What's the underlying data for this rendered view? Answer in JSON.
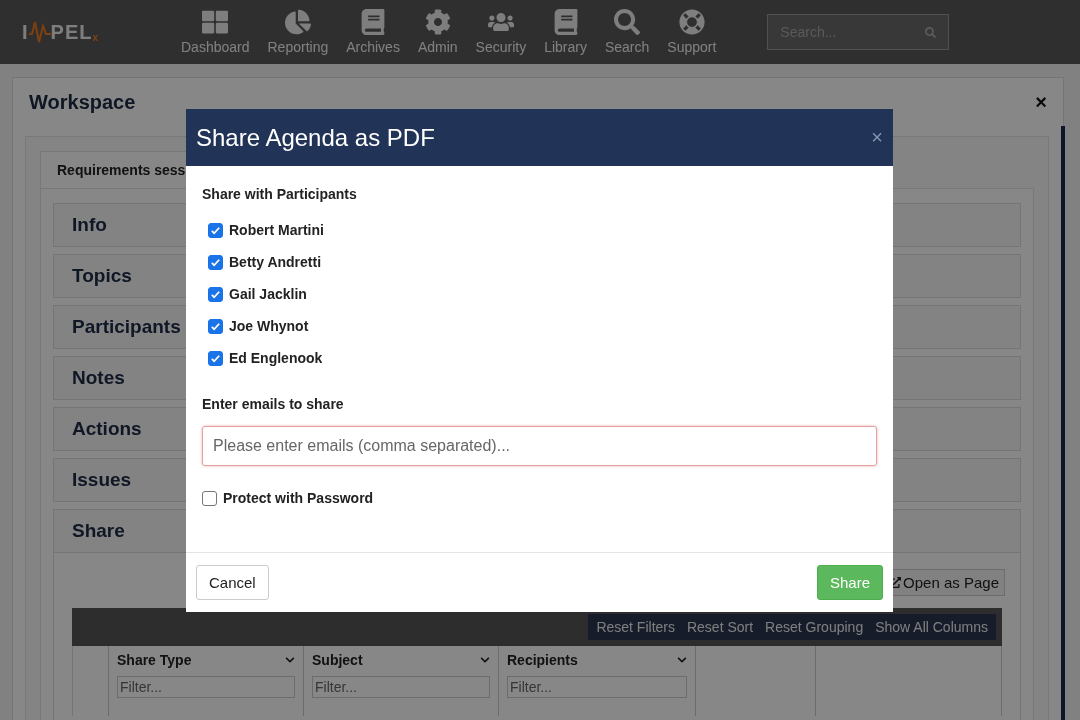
{
  "logo": {
    "left": "I",
    "right": "PEL",
    "superscript": "x"
  },
  "nav": [
    {
      "label": "Dashboard"
    },
    {
      "label": "Reporting"
    },
    {
      "label": "Archives"
    },
    {
      "label": "Admin"
    },
    {
      "label": "Security"
    },
    {
      "label": "Library"
    },
    {
      "label": "Search"
    },
    {
      "label": "Support"
    }
  ],
  "search": {
    "placeholder": "Search..."
  },
  "workspace": {
    "title": "Workspace",
    "close": "×",
    "tab": "Requirements sess",
    "sections": [
      {
        "title": "Info",
        "expanded": false
      },
      {
        "title": "Topics",
        "expanded": false
      },
      {
        "title": "Participants",
        "expanded": false
      },
      {
        "title": "Notes",
        "expanded": false
      },
      {
        "title": "Actions",
        "expanded": false
      },
      {
        "title": "Issues",
        "expanded": false
      },
      {
        "title": "Share",
        "expanded": true
      }
    ],
    "open_as_page": "Open as Page",
    "grid_actions": [
      "Reset Filters",
      "Reset Sort",
      "Reset Grouping",
      "Show All Columns"
    ],
    "columns": [
      {
        "title": "Share Type",
        "filter_placeholder": "Filter..."
      },
      {
        "title": "Subject",
        "filter_placeholder": "Filter..."
      },
      {
        "title": "Recipients",
        "filter_placeholder": "Filter..."
      }
    ]
  },
  "dialog": {
    "title": "Share Agenda as PDF",
    "close": "×",
    "participants_heading": "Share with Participants",
    "participants": [
      {
        "name": "Robert Martini",
        "checked": true
      },
      {
        "name": "Betty Andretti",
        "checked": true
      },
      {
        "name": "Gail Jacklin",
        "checked": true
      },
      {
        "name": "Joe Whynot",
        "checked": true
      },
      {
        "name": "Ed Englenook",
        "checked": true
      }
    ],
    "emails_heading": "Enter emails to share",
    "emails_placeholder": "Please enter emails (comma separated)...",
    "password": {
      "label": "Protect with Password",
      "checked": false
    },
    "buttons": [
      {
        "label": "Cancel",
        "kind": "default"
      },
      {
        "label": "Share",
        "kind": "primary"
      }
    ]
  }
}
